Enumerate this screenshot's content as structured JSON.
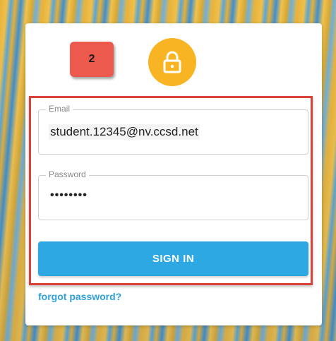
{
  "step_badge": {
    "number": "2",
    "color": "#ec5a4e"
  },
  "lock_icon": {
    "icon": "lock-icon",
    "color": "#f8b423"
  },
  "form": {
    "email": {
      "label": "Email",
      "value": "student.12345@nv.ccsd.net"
    },
    "password": {
      "label": "Password",
      "value": "••••••••"
    },
    "sign_in_label": "SIGN IN",
    "forgot_label": "forgot password?"
  },
  "colors": {
    "accent": "#2ea8e2",
    "highlight_border": "#d9423b"
  }
}
